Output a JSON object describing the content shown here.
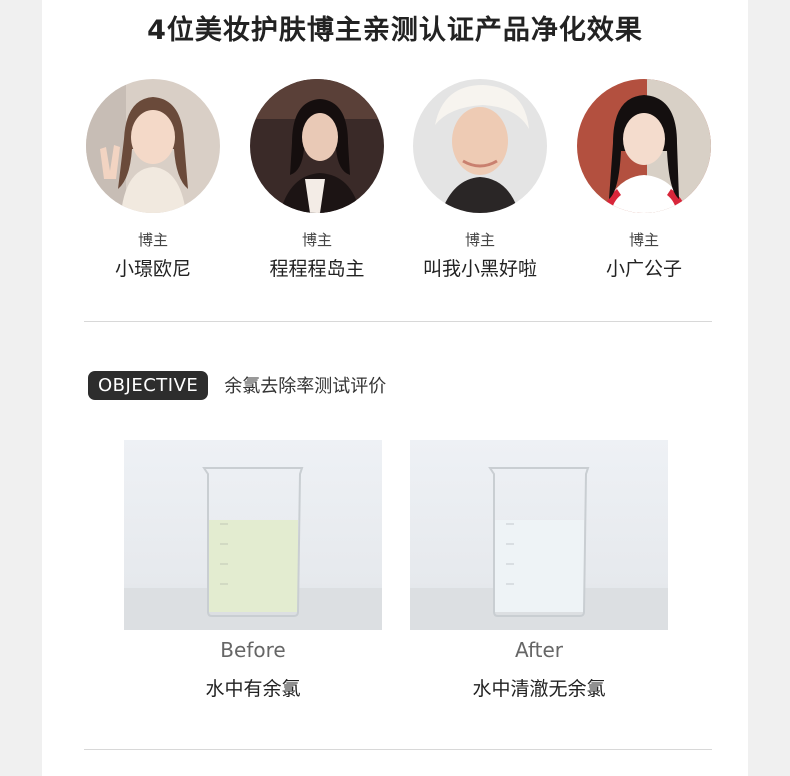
{
  "header": {
    "title": "4位美妆护肤博主亲测认证产品净化效果"
  },
  "bloggers": [
    {
      "role": "博主",
      "name": "小璟欧尼"
    },
    {
      "role": "博主",
      "name": "程程程岛主"
    },
    {
      "role": "博主",
      "name": "叫我小黑好啦"
    },
    {
      "role": "博主",
      "name": "小广公子"
    }
  ],
  "objective": {
    "badge": "OBJECTIVE",
    "text": "余氯去除率测试评价"
  },
  "comparison": [
    {
      "label_en": "Before",
      "label_cn": "水中有余氯",
      "liquid_color": "#e3ecd0"
    },
    {
      "label_en": "After",
      "label_cn": "水中清澈无余氯",
      "liquid_color": "#eef3f6"
    }
  ]
}
